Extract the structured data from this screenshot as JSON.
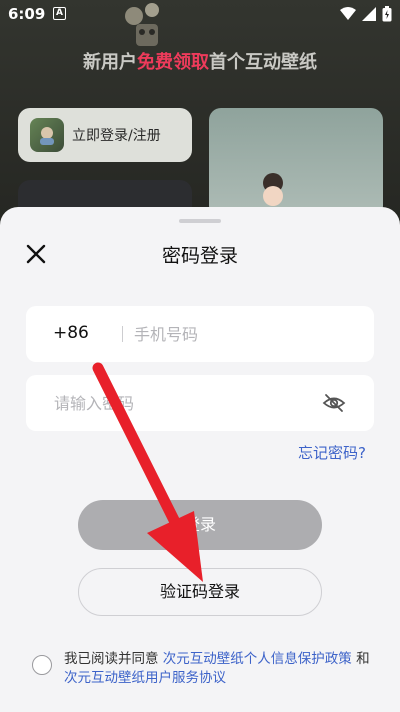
{
  "status_bar": {
    "time": "6:09",
    "notification_badge": "A"
  },
  "background": {
    "banner_prefix": "新用户",
    "banner_highlight": "免费领取",
    "banner_suffix": "首个互动壁纸",
    "login_card_label": "立即登录/注册"
  },
  "sheet": {
    "title": "密码登录",
    "phone": {
      "country_code": "+86",
      "placeholder": "手机号码"
    },
    "password": {
      "placeholder": "请输入密码"
    },
    "forgot_password": "忘记密码?",
    "login_button": "登录",
    "sms_login_button": "验证码登录",
    "agreement": {
      "prefix": "我已阅读并同意 ",
      "privacy_link": "次元互动壁纸个人信息保护政策",
      "middle": " 和 ",
      "service_link": "次元互动壁纸用户服务协议"
    }
  },
  "colors": {
    "accent_link": "#3d63c9",
    "highlight": "#ee3b5b",
    "arrow": "#e8202a"
  }
}
